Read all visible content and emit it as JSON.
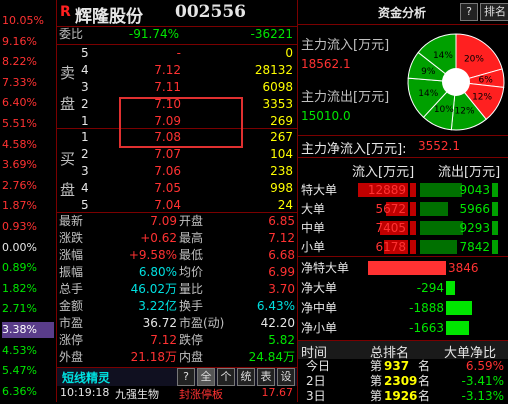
{
  "scale": [
    "10.05%",
    "9.16%",
    "8.22%",
    "7.33%",
    "6.40%",
    "5.51%",
    "4.58%",
    "3.69%",
    "2.76%",
    "1.87%",
    "0.93%",
    "0.00%",
    "0.89%",
    "1.82%",
    "2.71%",
    "3.38%",
    "4.53%",
    "5.47%",
    "6.36%"
  ],
  "header": {
    "logo": "R",
    "name": "辉隆股份",
    "code": "002556"
  },
  "weibi": {
    "label": "委比",
    "pct": "-91.74%",
    "diff": "-36221"
  },
  "sell": {
    "label1": "卖",
    "label2": "盘",
    "rows": [
      {
        "n": "5",
        "price": "-",
        "vol": "0"
      },
      {
        "n": "4",
        "price": "7.12",
        "vol": "28132"
      },
      {
        "n": "3",
        "price": "7.11",
        "vol": "6098"
      },
      {
        "n": "2",
        "price": "7.10",
        "vol": "3353"
      },
      {
        "n": "1",
        "price": "7.09",
        "vol": "269"
      }
    ]
  },
  "buy": {
    "label1": "买",
    "label2": "盘",
    "rows": [
      {
        "n": "1",
        "price": "7.08",
        "vol": "267"
      },
      {
        "n": "2",
        "price": "7.07",
        "vol": "104"
      },
      {
        "n": "3",
        "price": "7.06",
        "vol": "238"
      },
      {
        "n": "4",
        "price": "7.05",
        "vol": "998"
      },
      {
        "n": "5",
        "price": "7.04",
        "vol": "24"
      }
    ]
  },
  "stats": [
    {
      "l1": "最新",
      "v1": "7.09",
      "l2": "开盘",
      "v2": "6.85"
    },
    {
      "l1": "涨跌",
      "v1": "+0.62",
      "l2": "最高",
      "v2": "7.12"
    },
    {
      "l1": "涨幅",
      "v1": "+9.58%",
      "l2": "最低",
      "v2": "6.68"
    },
    {
      "l1": "振幅",
      "v1": "6.80%",
      "l2": "均价",
      "v2": "6.99"
    },
    {
      "l1": "总手",
      "v1": "46.02万",
      "l2": "量比",
      "v2": "3.70"
    },
    {
      "l1": "金额",
      "v1": "3.22亿",
      "l2": "换手",
      "v2": "6.43%"
    },
    {
      "l1": "市盈",
      "v1": "36.72",
      "l2": "市盈(动)",
      "v2": "42.20"
    },
    {
      "l1": "涨停",
      "v1": "7.12",
      "l2": "跌停",
      "v2": "5.82"
    },
    {
      "l1": "外盘",
      "v1": "21.18万",
      "l2": "内盘",
      "v2": "24.84万"
    }
  ],
  "sprite": {
    "title": "短线精灵",
    "buttons": [
      "?",
      "全",
      "个",
      "统",
      "表",
      "设"
    ],
    "time": "10:19:18",
    "stock": "九强生物",
    "event": "封涨停板",
    "value": "17.67"
  },
  "right": {
    "tab_fund": "资金分析",
    "help": "?",
    "tab_rank": "排名",
    "inflow_label": "主力流入[万元]",
    "inflow_value": "18562.1",
    "outflow_label": "主力流出[万元]",
    "outflow_value": "15010.0",
    "net_label": "主力净流入[万元]:",
    "net_value": "3552.1",
    "pie": {
      "type": "pie",
      "slices": [
        {
          "label": "20%",
          "value": 20,
          "color": "#ff2020"
        },
        {
          "label": "6%",
          "value": 6,
          "color": "#ff2020"
        },
        {
          "label": "12%",
          "value": 12,
          "color": "#ff2020"
        },
        {
          "label": "12%",
          "value": 12,
          "color": "#00a000"
        },
        {
          "label": "10%",
          "value": 10,
          "color": "#00a000"
        },
        {
          "label": "14%",
          "value": 14,
          "color": "#00a000"
        },
        {
          "label": "9%",
          "value": 9,
          "color": "#00a000"
        },
        {
          "label": "14%",
          "value": 14,
          "color": "#00a000"
        }
      ]
    },
    "table_headers": [
      "",
      "流入[万元]",
      "流出[万元]"
    ],
    "flow_rows": [
      {
        "label": "特大单",
        "in": "12889",
        "out": "9043",
        "in_frac": 1.0,
        "out_frac": 0.7
      },
      {
        "label": "大单",
        "in": "5672",
        "out": "5966",
        "in_frac": 0.44,
        "out_frac": 0.46
      },
      {
        "label": "中单",
        "in": "7405",
        "out": "9293",
        "in_frac": 0.57,
        "out_frac": 0.72
      },
      {
        "label": "小单",
        "in": "6178",
        "out": "7842",
        "in_frac": 0.48,
        "out_frac": 0.61
      }
    ],
    "net_rows": [
      {
        "label": "净特大单",
        "value": "3846",
        "frac": 1.0,
        "color": "#ff3232"
      },
      {
        "label": "净大单",
        "value": "-294",
        "frac": 0.08,
        "color": "#00e600"
      },
      {
        "label": "净中单",
        "value": "-1888",
        "frac": 0.49,
        "color": "#00e600"
      },
      {
        "label": "净小单",
        "value": "-1663",
        "frac": 0.43,
        "color": "#00e600"
      }
    ],
    "rank_headers": [
      "时间",
      "总排名",
      "大单净比"
    ],
    "rank_rows": [
      {
        "time": "今日",
        "prefix": "第",
        "rank": "937",
        "suffix": "名",
        "ratio": "6.59%"
      },
      {
        "time": "2日",
        "prefix": "第",
        "rank": "2309",
        "suffix": "名",
        "ratio": "-3.41%"
      },
      {
        "time": "3日",
        "prefix": "第",
        "rank": "1926",
        "suffix": "名",
        "ratio": "-3.13%"
      }
    ]
  }
}
